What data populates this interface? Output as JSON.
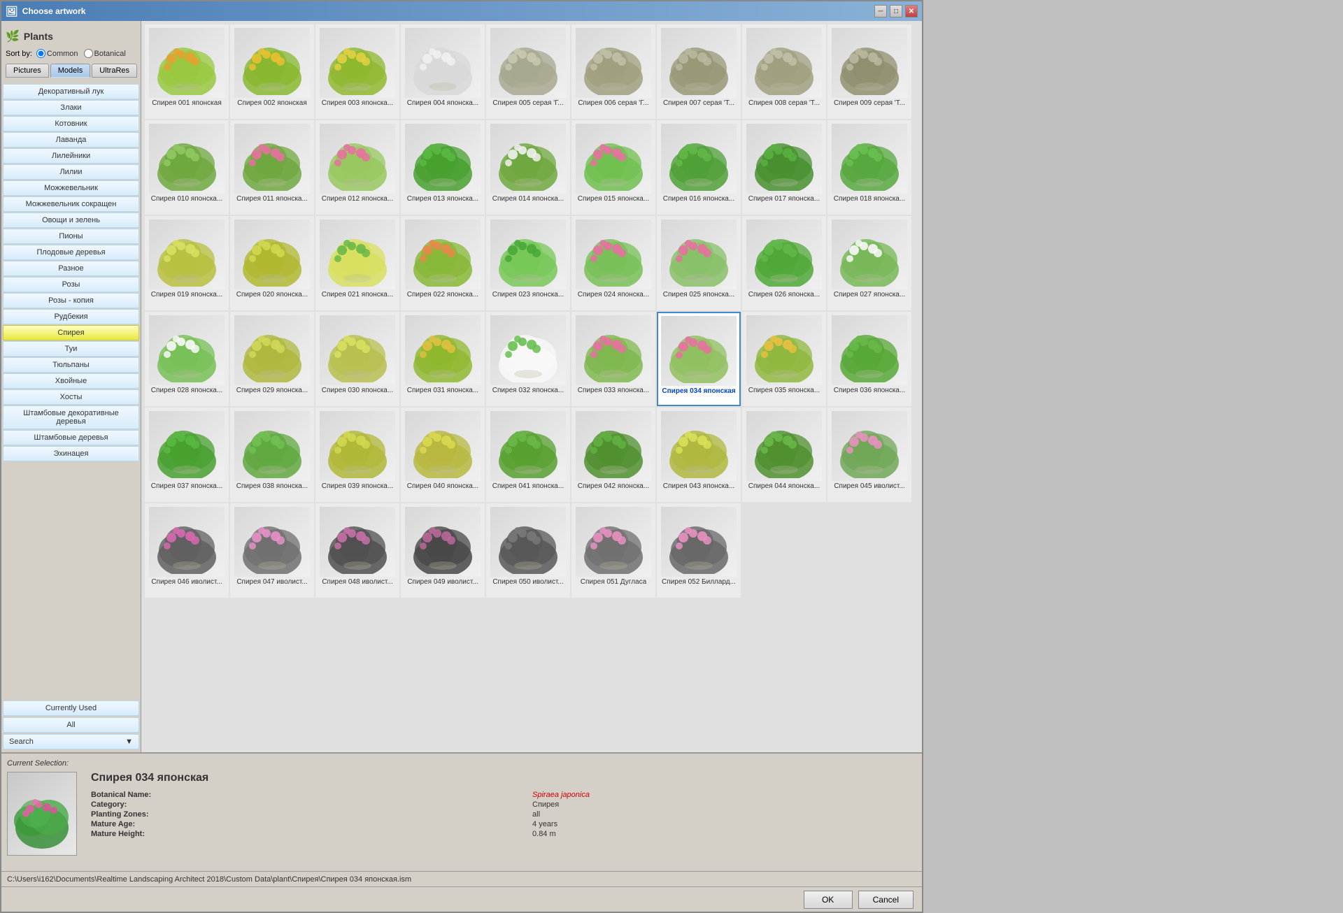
{
  "window": {
    "title": "Choose artwork",
    "icon": "🌿"
  },
  "header": {
    "plants_label": "Plants",
    "sort_by_label": "Sort by:",
    "sort_common": "Common",
    "sort_botanical": "Botanical",
    "tab_pictures": "Pictures",
    "tab_models": "Models",
    "tab_ultrares": "UltraRes"
  },
  "sidebar": {
    "categories": [
      "Декоративный лук",
      "Злаки",
      "Котовник",
      "Лаванда",
      "Лилейники",
      "Лилии",
      "Можжевельник",
      "Можжевельник сокращен",
      "Овощи и зелень",
      "Пионы",
      "Плодовые деревья",
      "Разное",
      "Розы",
      "Розы - копия",
      "Рудбекия",
      "Спирея",
      "Туи",
      "Тюльпаны",
      "Хвойные",
      "Хосты",
      "Штамбовые декоративные деревья",
      "Штамбовые деревья",
      "Эхинацея"
    ],
    "currently_used": "Currently Used",
    "all_label": "All",
    "search_label": "Search"
  },
  "plants": [
    {
      "id": 1,
      "label": "Спирея 001 японская",
      "selected": false,
      "color1": "#e8a030",
      "color2": "#98c840"
    },
    {
      "id": 2,
      "label": "Спирея 002 японская",
      "selected": false,
      "color1": "#e8c030",
      "color2": "#88b830"
    },
    {
      "id": 3,
      "label": "Спирея 003 японска...",
      "selected": false,
      "color1": "#e0d040",
      "color2": "#90b830"
    },
    {
      "id": 4,
      "label": "Спирея 004 японска...",
      "selected": false,
      "color1": "#f0f0f0",
      "color2": "#d8d8d8"
    },
    {
      "id": 5,
      "label": "Спирея 005 серая 'Г...",
      "selected": false,
      "color1": "#c8c8b0",
      "color2": "#a8a890"
    },
    {
      "id": 6,
      "label": "Спирея 006 серая 'Г...",
      "selected": false,
      "color1": "#c0c0a8",
      "color2": "#a0a080"
    },
    {
      "id": 7,
      "label": "Спирея 007 серая 'Т...",
      "selected": false,
      "color1": "#b8b8a0",
      "color2": "#989878"
    },
    {
      "id": 8,
      "label": "Спирея 008 серая 'Т...",
      "selected": false,
      "color1": "#c0c0a8",
      "color2": "#a0a080"
    },
    {
      "id": 9,
      "label": "Спирея 009 серая 'Т...",
      "selected": false,
      "color1": "#b8b8a0",
      "color2": "#909070"
    },
    {
      "id": 10,
      "label": "Спирея 010 японска...",
      "selected": false,
      "color1": "#90c860",
      "color2": "#70a840"
    },
    {
      "id": 11,
      "label": "Спирея 011 японска...",
      "selected": false,
      "color1": "#e870a0",
      "color2": "#70a840"
    },
    {
      "id": 12,
      "label": "Спирея 012 японска...",
      "selected": false,
      "color1": "#e870a0",
      "color2": "#98c860"
    },
    {
      "id": 13,
      "label": "Спирея 013 японска...",
      "selected": false,
      "color1": "#58b840",
      "color2": "#48a030"
    },
    {
      "id": 14,
      "label": "Спирея 014 японска...",
      "selected": false,
      "color1": "#f0f0f0",
      "color2": "#70a840"
    },
    {
      "id": 15,
      "label": "Спирея 015 японска...",
      "selected": false,
      "color1": "#e870a0",
      "color2": "#70c050"
    },
    {
      "id": 16,
      "label": "Спирея 016 японска...",
      "selected": false,
      "color1": "#60b848",
      "color2": "#50a038"
    },
    {
      "id": 17,
      "label": "Спирея 017 японска...",
      "selected": false,
      "color1": "#58b040",
      "color2": "#489030"
    },
    {
      "id": 18,
      "label": "Спирея 018 японска...",
      "selected": false,
      "color1": "#68c050",
      "color2": "#58a840"
    },
    {
      "id": 19,
      "label": "Спирея 019 японска...",
      "selected": false,
      "color1": "#d8e060",
      "color2": "#b8c040"
    },
    {
      "id": 20,
      "label": "Спирея 020 японска...",
      "selected": false,
      "color1": "#d0d850",
      "color2": "#b0b830"
    },
    {
      "id": 21,
      "label": "Спирея 021 японска...",
      "selected": false,
      "color1": "#68b848",
      "color2": "#d8e060"
    },
    {
      "id": 22,
      "label": "Спирея 022 японска...",
      "selected": false,
      "color1": "#e88848",
      "color2": "#88b838"
    },
    {
      "id": 23,
      "label": "Спирея 023 японска...",
      "selected": false,
      "color1": "#48a838",
      "color2": "#78c858"
    },
    {
      "id": 24,
      "label": "Спирея 024 японска...",
      "selected": false,
      "color1": "#e870a0",
      "color2": "#78c058"
    },
    {
      "id": 25,
      "label": "Спирея 025 японска...",
      "selected": false,
      "color1": "#e870a0",
      "color2": "#88c068"
    },
    {
      "id": 26,
      "label": "Спирея 026 японска...",
      "selected": false,
      "color1": "#60b848",
      "color2": "#50a838"
    },
    {
      "id": 27,
      "label": "Спирея 027 японска...",
      "selected": false,
      "color1": "#f8f8f8",
      "color2": "#78b858"
    },
    {
      "id": 28,
      "label": "Спирея 028 японска...",
      "selected": false,
      "color1": "#f8f8f8",
      "color2": "#78c058"
    },
    {
      "id": 29,
      "label": "Спирея 029 японска...",
      "selected": false,
      "color1": "#d0d858",
      "color2": "#b0b840"
    },
    {
      "id": 30,
      "label": "Спирея 030 японска...",
      "selected": false,
      "color1": "#d8e060",
      "color2": "#b8c050"
    },
    {
      "id": 31,
      "label": "Спирея 031 японска...",
      "selected": false,
      "color1": "#e0c040",
      "color2": "#90b830"
    },
    {
      "id": 32,
      "label": "Спирея 032 японска...",
      "selected": false,
      "color1": "#68c050",
      "color2": "#f8f8f8"
    },
    {
      "id": 33,
      "label": "Спирея 033 японска...",
      "selected": false,
      "color1": "#e870a0",
      "color2": "#80b850"
    },
    {
      "id": 34,
      "label": "Спирея 034 японская",
      "selected": true,
      "color1": "#e870a0",
      "color2": "#90c060"
    },
    {
      "id": 35,
      "label": "Спирея 035 японска...",
      "selected": false,
      "color1": "#e8c040",
      "color2": "#90b840"
    },
    {
      "id": 36,
      "label": "Спирея 036 японска...",
      "selected": false,
      "color1": "#68b848",
      "color2": "#58a838"
    },
    {
      "id": 37,
      "label": "Спирея 037 японска...",
      "selected": false,
      "color1": "#58b840",
      "color2": "#48a030"
    },
    {
      "id": 38,
      "label": "Спирея 038 японска...",
      "selected": false,
      "color1": "#70c050",
      "color2": "#60a840"
    },
    {
      "id": 39,
      "label": "Спирея 039 японска...",
      "selected": false,
      "color1": "#d0d850",
      "color2": "#b0b838"
    },
    {
      "id": 40,
      "label": "Спирея 040 японска...",
      "selected": false,
      "color1": "#d8d850",
      "color2": "#b8b840"
    },
    {
      "id": 41,
      "label": "Спирея 041 японска...",
      "selected": false,
      "color1": "#68b848",
      "color2": "#58a030"
    },
    {
      "id": 42,
      "label": "Спирея 042 японска...",
      "selected": false,
      "color1": "#60b040",
      "color2": "#509030"
    },
    {
      "id": 43,
      "label": "Спирея 043 японска...",
      "selected": false,
      "color1": "#d8e058",
      "color2": "#b0b840"
    },
    {
      "id": 44,
      "label": "Спирея 044 японска...",
      "selected": false,
      "color1": "#68b848",
      "color2": "#509030"
    },
    {
      "id": 45,
      "label": "Спирея 045 иволист...",
      "selected": false,
      "color1": "#e890c0",
      "color2": "#70a858"
    },
    {
      "id": 46,
      "label": "Спирея 046 иволист...",
      "selected": false,
      "color1": "#d868b0",
      "color2": "#606060"
    },
    {
      "id": 47,
      "label": "Спирея 047 иволист...",
      "selected": false,
      "color1": "#e890c8",
      "color2": "#707070"
    },
    {
      "id": 48,
      "label": "Спирея 048 иволист...",
      "selected": false,
      "color1": "#c870a8",
      "color2": "#505050"
    },
    {
      "id": 49,
      "label": "Спирея 049 иволист...",
      "selected": false,
      "color1": "#b86898",
      "color2": "#484848"
    },
    {
      "id": 50,
      "label": "Спирея 050 иволист...",
      "selected": false,
      "color1": "#787878",
      "color2": "#585858"
    },
    {
      "id": 51,
      "label": "Спирея 051 Дугласа",
      "selected": false,
      "color1": "#e890c0",
      "color2": "#707070"
    },
    {
      "id": 52,
      "label": "Спирея 052 Биллард...",
      "selected": false,
      "color1": "#e890c0",
      "color2": "#686868"
    }
  ],
  "current_selection": {
    "label": "Current Selection:",
    "name": "Спирея 034 японская",
    "botanical_label": "Botanical Name:",
    "botanical_value": "Spiraea japonica",
    "category_label": "Category:",
    "category_value": "Спирея",
    "planting_zones_label": "Planting Zones:",
    "planting_zones_value": "all",
    "mature_age_label": "Mature Age:",
    "mature_age_value": "4 years",
    "mature_height_label": "Mature Height:",
    "mature_height_value": "0.84 m"
  },
  "footer": {
    "path": "C:\\Users\\i162\\Documents\\Realtime Landscaping Architect 2018\\Custom Data\\plant\\Спирея\\Спирея 034 японская.ism",
    "ok_label": "OK",
    "cancel_label": "Cancel"
  }
}
